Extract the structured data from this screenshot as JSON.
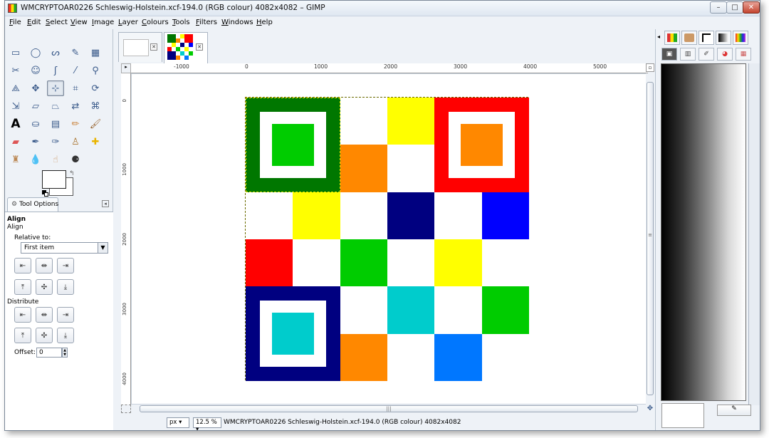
{
  "window": {
    "title": "WMCRYPTOAR0226 Schleswig-Holstein.xcf-194.0 (RGB colour) 4082x4082 – GIMP",
    "controls": {
      "minimize": "–",
      "maximize": "□",
      "close": "✕"
    }
  },
  "menubar": [
    "File",
    "Edit",
    "Select",
    "View",
    "Image",
    "Layer",
    "Colours",
    "Tools",
    "Filters",
    "Windows",
    "Help"
  ],
  "toolbox": {
    "tool_options_tab": "Tool Options",
    "heading": "Align",
    "subheading": "Align",
    "relative_to_label": "Relative to:",
    "relative_to_value": "First item",
    "distribute_label": "Distribute",
    "offset_label": "Offset:",
    "offset_value": "0"
  },
  "canvas": {
    "ruler_h": [
      "-1000",
      "0",
      "1000",
      "2000",
      "3000",
      "4000",
      "5000"
    ],
    "ruler_v": [
      "0",
      "1000",
      "2000",
      "3000",
      "4000"
    ],
    "unit": "px",
    "zoom": "12.5 %",
    "status": "WMCRYPTOAR0226 Schleswig-Holstein.xcf-194.0 (RGB colour) 4082x4082"
  },
  "image_grid": {
    "cells": [
      [
        "",
        "",
        "#ffffff",
        "#ffff00",
        "",
        ""
      ],
      [
        "",
        "",
        "#ff8800",
        "#ffffff",
        "",
        ""
      ],
      [
        "#ffffff",
        "#ffff00",
        "#ffffff",
        "#000080",
        "#ffffff",
        "#0000ff"
      ],
      [
        "#ff0000",
        "#ffffff",
        "#00cc00",
        "#ffffff",
        "#ffff00",
        "#ffffff"
      ],
      [
        "",
        "",
        "#ffffff",
        "#00cccc",
        "#ffffff",
        "#00cc00"
      ],
      [
        "",
        "",
        "#ff8800",
        "#ffffff",
        "#0077ff",
        "#ffffff"
      ]
    ],
    "corner_blocks": [
      {
        "name": "top-left",
        "outer": "#007700",
        "inner": "#00cc00"
      },
      {
        "name": "top-right",
        "outer": "#ff0000",
        "inner": "#ff8800"
      },
      {
        "name": "bottom-left",
        "outer": "#000080",
        "inner": "#00cccc"
      }
    ]
  }
}
